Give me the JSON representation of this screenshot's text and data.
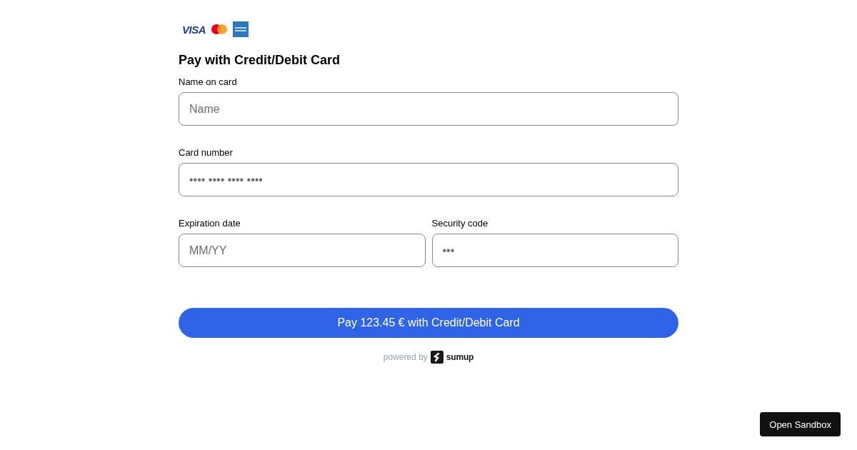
{
  "brands": {
    "visa": "VISA"
  },
  "title": "Pay with Credit/Debit Card",
  "fields": [
    {
      "label": "Name on card",
      "placeholder": "Name"
    },
    {
      "label": "Card number",
      "placeholder": "•••• •••• •••• ••••"
    }
  ],
  "row_fields": [
    {
      "label": "Expiration date",
      "placeholder": "MM/YY"
    },
    {
      "label": "Security code",
      "placeholder": "•••"
    }
  ],
  "pay_button": "Pay 123.45 € with Credit/Debit Card",
  "powered_by": {
    "text": "powered by",
    "brand": "sumup"
  },
  "sandbox_button": "Open Sandbox"
}
